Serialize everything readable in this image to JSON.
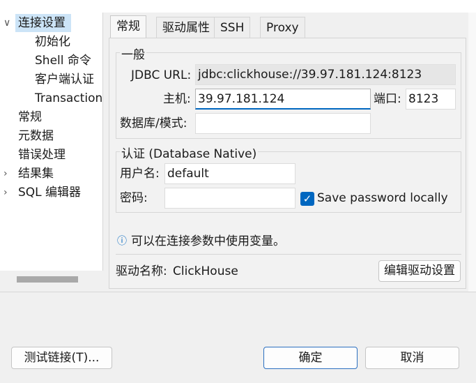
{
  "tree": {
    "items": [
      {
        "label": "连接设置",
        "chevron": "∨"
      },
      {
        "label": "初始化"
      },
      {
        "label": "Shell 命令"
      },
      {
        "label": "客户端认证"
      },
      {
        "label": "Transaction"
      },
      {
        "label": "常规"
      },
      {
        "label": "元数据"
      },
      {
        "label": "错误处理"
      },
      {
        "label": "结果集",
        "chevron": "›"
      },
      {
        "label": "SQL 编辑器",
        "chevron": "›"
      }
    ]
  },
  "tabs": [
    {
      "label": "常规",
      "active": true
    },
    {
      "label": "驱动属性"
    },
    {
      "label": "SSH"
    },
    {
      "label": "Proxy"
    }
  ],
  "general": {
    "title": "一般",
    "jdbc_label": "JDBC URL:",
    "jdbc_value": "jdbc:clickhouse://39.97.181.124:8123",
    "host_label": "主机:",
    "host_value": "39.97.181.124",
    "port_label": "端口:",
    "port_value": "8123",
    "db_label": "数据库/模式:",
    "db_value": ""
  },
  "auth": {
    "title": "认证 (Database Native)",
    "user_label": "用户名:",
    "user_value": "default",
    "password_label": "密码:",
    "password_value": "",
    "save_password_label": "Save password locally",
    "save_password_checked": true
  },
  "info": {
    "icon": "info-icon",
    "text": "可以在连接参数中使用变量。"
  },
  "driver": {
    "label": "驱动名称:",
    "name": "ClickHouse",
    "edit_button": "编辑驱动设置"
  },
  "buttons": {
    "test": "测试链接(T)...",
    "ok": "确定",
    "cancel": "取消"
  },
  "colors": {
    "accent": "#0067c0",
    "selection": "#cce4f7"
  }
}
